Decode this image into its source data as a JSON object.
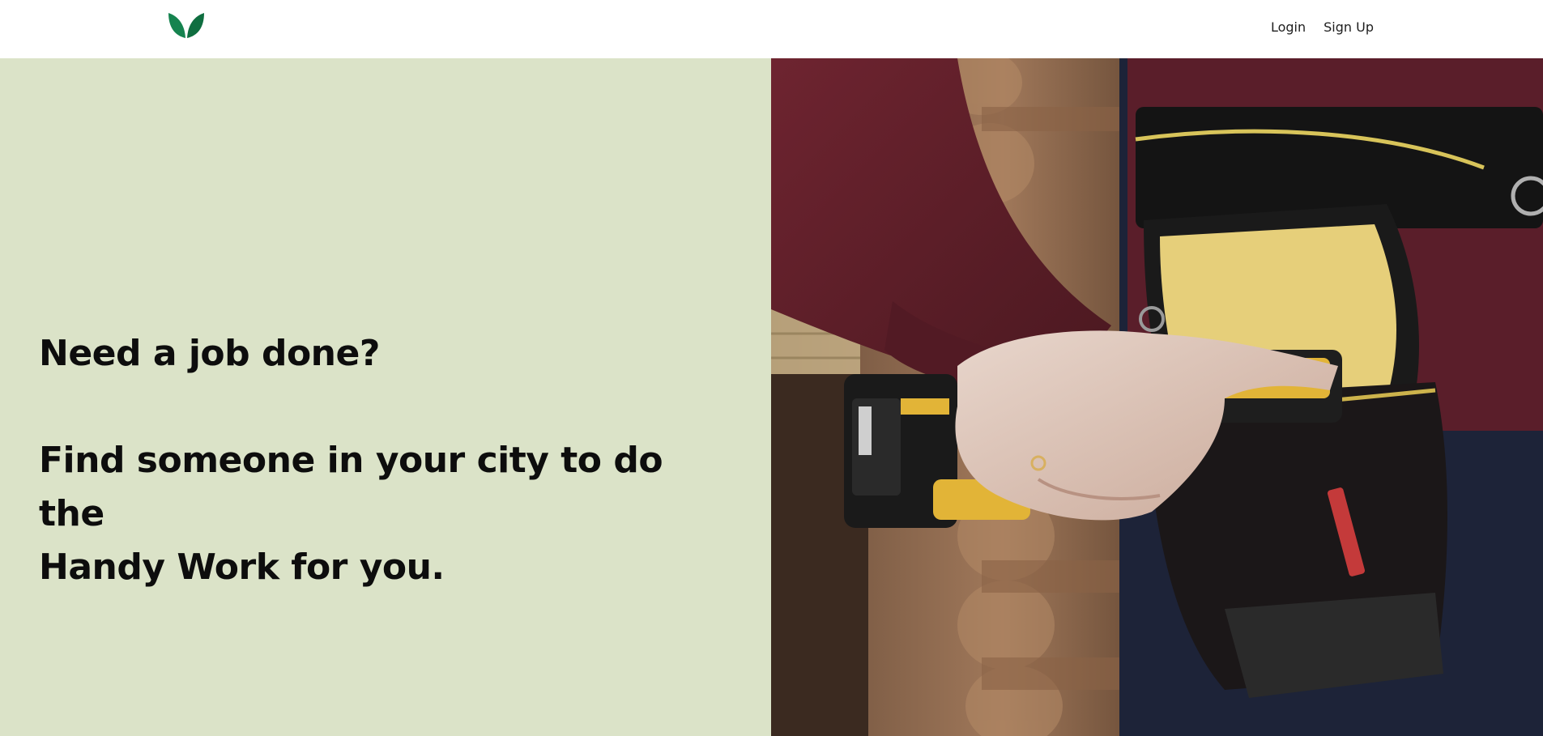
{
  "header": {
    "logo_icon": "leaf-logo-icon",
    "brand_color": "#1a7a4a",
    "nav": {
      "login_label": "Login",
      "signup_label": "Sign Up"
    }
  },
  "hero": {
    "background_color": "#dbe3c8",
    "headline_line1": "Need a job done?",
    "headline_line2": "Find someone in your city to do the",
    "headline_line3": "Handy Work for you.",
    "image_description_icon": "worker-with-drill-photo"
  }
}
